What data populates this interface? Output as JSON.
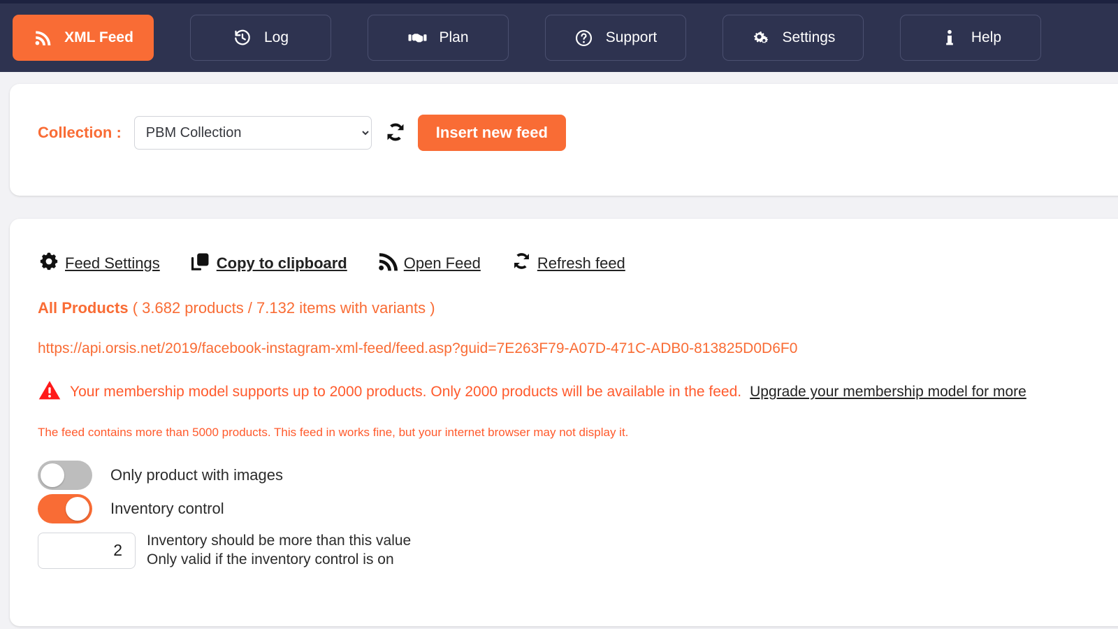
{
  "navbar": {
    "items": [
      {
        "label": "XML Feed",
        "icon": "rss-icon",
        "active": true
      },
      {
        "label": "Log",
        "icon": "history-icon",
        "active": false
      },
      {
        "label": "Plan",
        "icon": "handshake-icon",
        "active": false
      },
      {
        "label": "Support",
        "icon": "question-circle-icon",
        "active": false
      },
      {
        "label": "Settings",
        "icon": "gears-icon",
        "active": false
      },
      {
        "label": "Help",
        "icon": "info-icon",
        "active": false
      }
    ]
  },
  "collection_card": {
    "label": "Collection :",
    "selected": "PBM Collection",
    "options": [
      "PBM Collection"
    ],
    "refresh_icon": "refresh-icon",
    "insert_button": "Insert new feed"
  },
  "feed_card": {
    "actions": [
      {
        "label": "Feed Settings",
        "icon": "gear-icon",
        "bold": false
      },
      {
        "label": "Copy to clipboard",
        "icon": "clipboard-icon",
        "bold": true
      },
      {
        "label": "Open Feed",
        "icon": "rss-icon",
        "bold": false
      },
      {
        "label": "Refresh feed",
        "icon": "refresh-icon",
        "bold": false
      }
    ],
    "products_title": "All Products",
    "products_counts": "( 3.682 products / 7.132 items with variants )",
    "feed_url": "https://api.orsis.net/2019/facebook-instagram-xml-feed/feed.asp?guid=7E263F79-A07D-471C-ADB0-813825D0D6F0",
    "warning_icon": "warning-triangle-icon",
    "warning_text": "Your membership model supports up to 2000 products. Only 2000 products will be available in the feed.",
    "warning_link": "Upgrade your membership model for more",
    "note_text": "The feed contains more than 5000 products. This feed in works fine, but your internet browser may not display it.",
    "toggles": [
      {
        "label": "Only product with images",
        "on": false
      },
      {
        "label": "Inventory control",
        "on": true
      }
    ],
    "inventory_value": "2",
    "inventory_desc_line1": "Inventory should be more than this value",
    "inventory_desc_line2": "Only valid if the inventory control is on"
  },
  "colors": {
    "accent": "#f96c35",
    "navbar": "#2e3350",
    "warning_red": "#ff2020",
    "note_red": "#ff5a2c"
  }
}
